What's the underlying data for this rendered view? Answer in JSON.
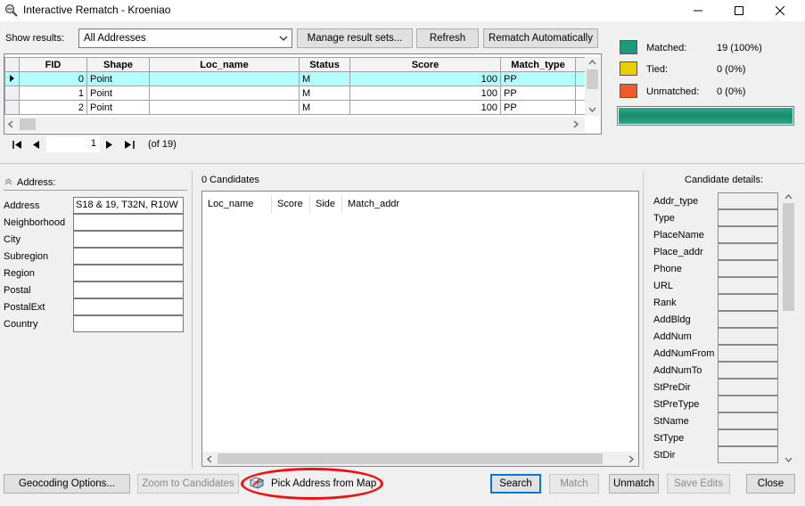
{
  "window": {
    "title": "Interactive Rematch - Kroeniao"
  },
  "toolbar": {
    "show_results_label": "Show results:",
    "show_results_value": "All Addresses",
    "manage_label": "Manage result sets...",
    "refresh_label": "Refresh",
    "rematch_auto_label": "Rematch Automatically"
  },
  "grid": {
    "columns": [
      "FID",
      "Shape",
      "Loc_name",
      "Status",
      "Score",
      "Match_type"
    ],
    "rows": [
      {
        "fid": "0",
        "shape": "Point",
        "loc_name": "",
        "status": "M",
        "score": "100",
        "match_type": "PP"
      },
      {
        "fid": "1",
        "shape": "Point",
        "loc_name": "",
        "status": "M",
        "score": "100",
        "match_type": "PP"
      },
      {
        "fid": "2",
        "shape": "Point",
        "loc_name": "",
        "status": "M",
        "score": "100",
        "match_type": "PP"
      }
    ],
    "selected_row": 0
  },
  "navigator": {
    "current": "1",
    "of": "(of 19)"
  },
  "stats": {
    "matched_label": "Matched:",
    "matched_value": "19 (100%)",
    "matched_color": "#1a9c7c",
    "tied_label": "Tied:",
    "tied_value": "0 (0%)",
    "tied_color": "#e6d000",
    "unmatched_label": "Unmatched:",
    "unmatched_value": "0 (0%)",
    "unmatched_color": "#f05a28",
    "progress_fraction": 1.0
  },
  "address": {
    "header": "Address:",
    "fields": [
      {
        "label": "Address",
        "value": "S18 & 19, T32N, R10W"
      },
      {
        "label": "Neighborhood",
        "value": ""
      },
      {
        "label": "City",
        "value": ""
      },
      {
        "label": "Subregion",
        "value": ""
      },
      {
        "label": "Region",
        "value": ""
      },
      {
        "label": "Postal",
        "value": ""
      },
      {
        "label": "PostalExt",
        "value": ""
      },
      {
        "label": "Country",
        "value": ""
      }
    ]
  },
  "candidates": {
    "count_label": "0 Candidates",
    "columns": [
      "Loc_name",
      "Score",
      "Side",
      "Match_addr"
    ]
  },
  "details": {
    "header": "Candidate details:",
    "fields": [
      "Addr_type",
      "Type",
      "PlaceName",
      "Place_addr",
      "Phone",
      "URL",
      "Rank",
      "AddBldg",
      "AddNum",
      "AddNumFrom",
      "AddNumTo",
      "StPreDir",
      "StPreType",
      "StName",
      "StType",
      "StDir"
    ]
  },
  "buttons": {
    "geocoding_options": "Geocoding Options...",
    "zoom_to_candidates": "Zoom to Candidates",
    "pick_address": "Pick Address from Map",
    "search": "Search",
    "match": "Match",
    "unmatch": "Unmatch",
    "save_edits": "Save Edits",
    "close": "Close"
  }
}
